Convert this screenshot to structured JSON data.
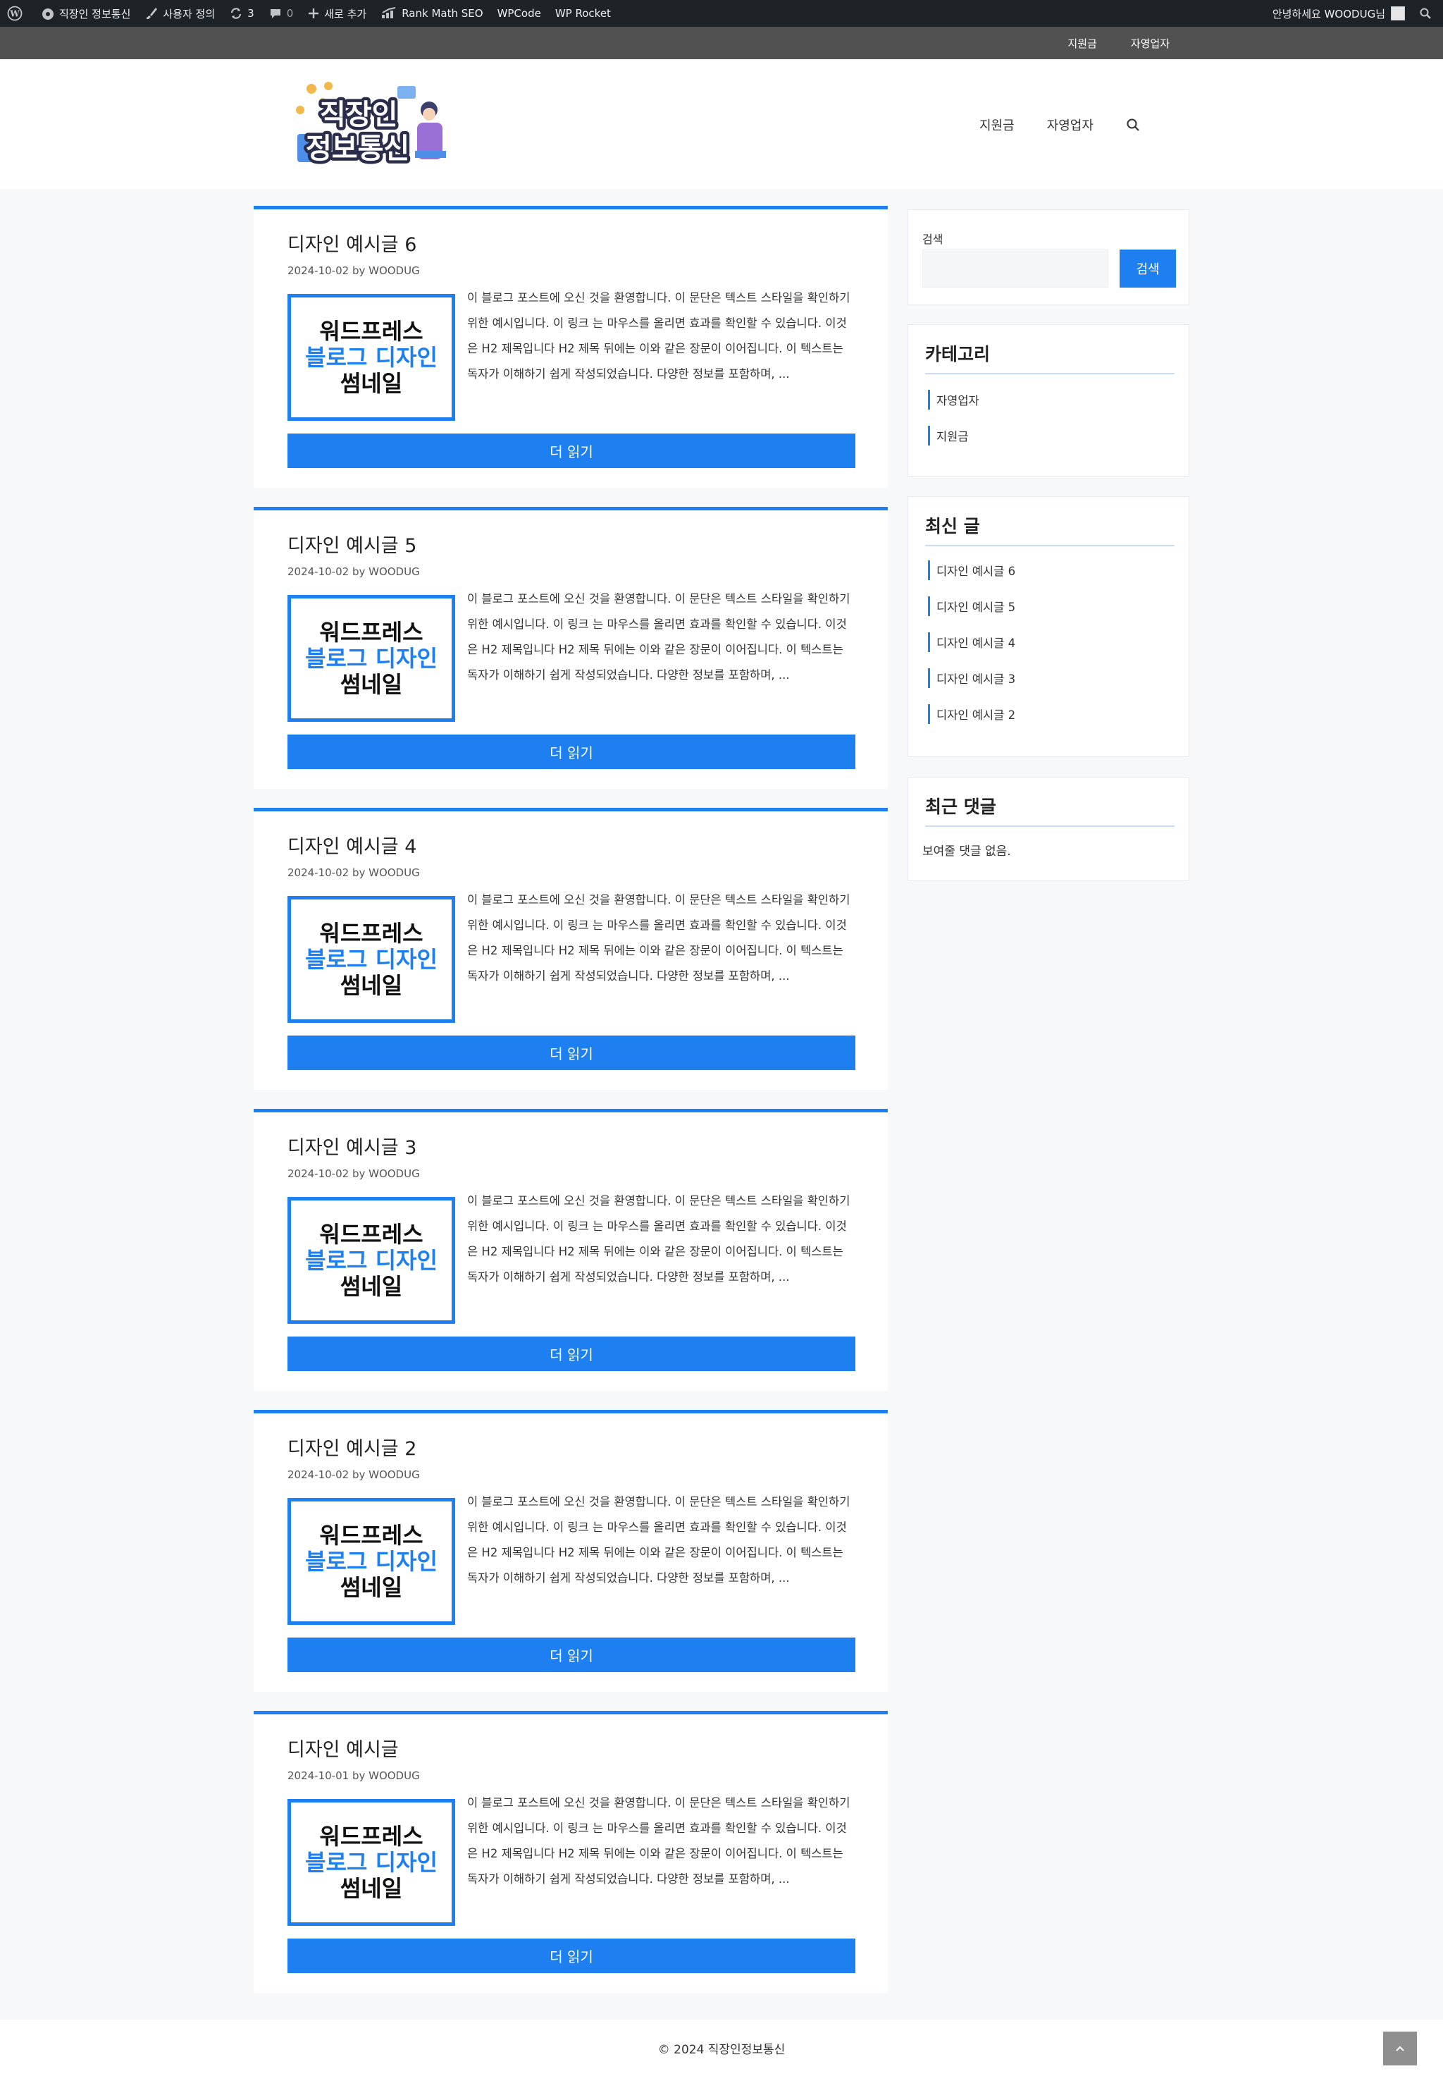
{
  "adminbar": {
    "site_name": "직장인 정보통신",
    "customize": "사용자 정의",
    "updates_count": "3",
    "comments_count": "0",
    "new": "새로 추가",
    "rankmath": "Rank Math SEO",
    "wpcode": "WPCode",
    "wprocket": "WP Rocket",
    "greeting": "안녕하세요 WOODUG님"
  },
  "topnav": {
    "items": [
      "지원금",
      "자영업자"
    ]
  },
  "header": {
    "logo_line1": "직장인",
    "logo_line2": "정보통신",
    "nav": [
      "지원금",
      "자영업자"
    ]
  },
  "thumb": {
    "line1": "워드프레스",
    "line2": "블로그 디자인",
    "line3": "썸네일"
  },
  "read_more": "더 읽기",
  "excerpt": "이 블로그 포스트에 오신 것을 환영합니다. 이 문단은 텍스트 스타일을 확인하기 위한 예시입니다. 이 링크 는 마우스를 올리면 효과를 확인할 수 있습니다. 이것은 H2 제목입니다 H2 제목 뒤에는 이와 같은 장문이 이어집니다. 이 텍스트는 독자가 이해하기 쉽게 작성되었습니다. 다양한 정보를 포함하며, ...",
  "posts": [
    {
      "title": "디자인 예시글 6",
      "meta": "2024-10-02 by WOODUG"
    },
    {
      "title": "디자인 예시글 5",
      "meta": "2024-10-02 by WOODUG"
    },
    {
      "title": "디자인 예시글 4",
      "meta": "2024-10-02 by WOODUG"
    },
    {
      "title": "디자인 예시글 3",
      "meta": "2024-10-02 by WOODUG"
    },
    {
      "title": "디자인 예시글 2",
      "meta": "2024-10-02 by WOODUG"
    },
    {
      "title": "디자인 예시글",
      "meta": "2024-10-01 by WOODUG"
    }
  ],
  "sidebar": {
    "search": {
      "label": "검색",
      "button": "검색",
      "value": ""
    },
    "categories": {
      "title": "카테고리",
      "items": [
        "자영업자",
        "지원금"
      ]
    },
    "recent_posts": {
      "title": "최신 글",
      "items": [
        "디자인 예시글 6",
        "디자인 예시글 5",
        "디자인 예시글 4",
        "디자인 예시글 3",
        "디자인 예시글 2"
      ]
    },
    "recent_comments": {
      "title": "최근 댓글",
      "empty": "보여줄 댓글 없음."
    }
  },
  "footer": {
    "copyright": "© 2024 직장인정보통신"
  },
  "colors": {
    "accent": "#1e7ff0",
    "adminbar": "#1d2327",
    "topnav": "#515151"
  }
}
